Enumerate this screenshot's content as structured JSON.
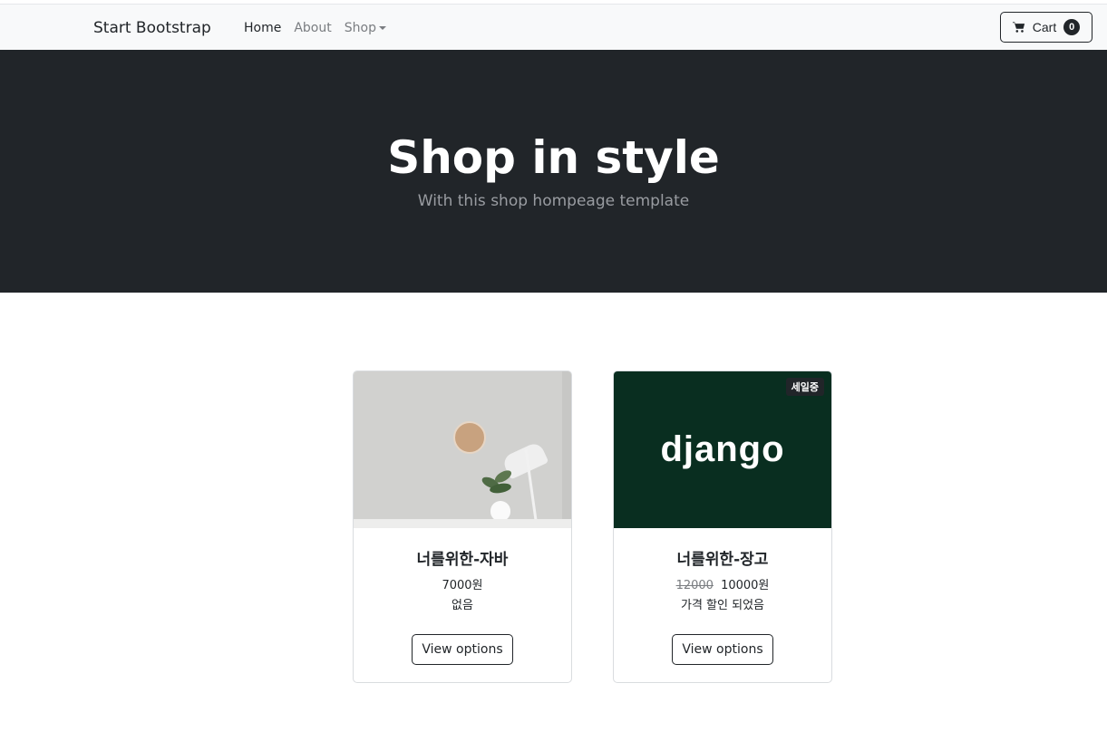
{
  "navbar": {
    "brand": "Start Bootstrap",
    "links": [
      "Home",
      "About",
      "Shop"
    ],
    "cart_label": "Cart",
    "cart_count": "0"
  },
  "hero": {
    "title": "Shop in style",
    "subtitle": "With this shop hompeage template"
  },
  "products": [
    {
      "name": "너를위한-자바",
      "price": "7000원",
      "note": "없음",
      "button": "View options"
    },
    {
      "name": "너를위한-장고",
      "badge": "세일중",
      "old_price": "12000",
      "price": "10000원",
      "note": "가격 할인 되었음",
      "image_text": "django",
      "button": "View options"
    }
  ]
}
